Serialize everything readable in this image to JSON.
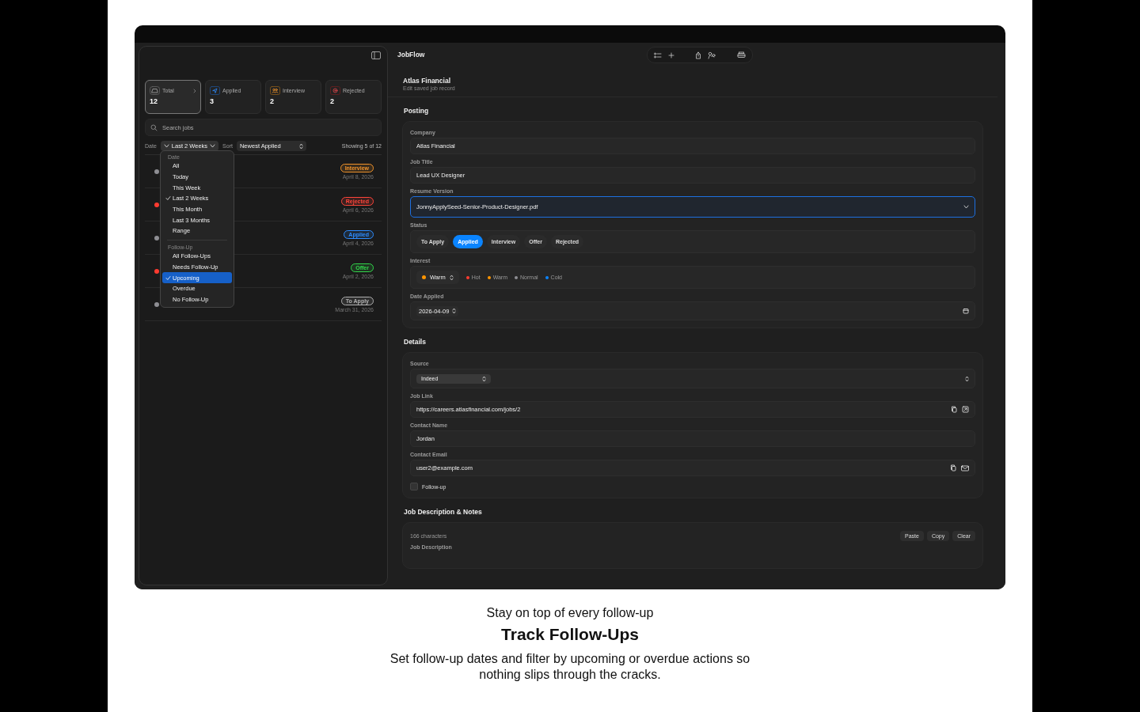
{
  "sidebar": {
    "stats": [
      {
        "kind": "total",
        "label": "Total",
        "value": "12",
        "selected": true
      },
      {
        "kind": "applied",
        "label": "Applied",
        "value": "3",
        "selected": false
      },
      {
        "kind": "interview",
        "label": "Interview",
        "value": "2",
        "selected": false
      },
      {
        "kind": "rejected",
        "label": "Rejected",
        "value": "2",
        "selected": false
      }
    ],
    "search": {
      "placeholder": "Search jobs"
    },
    "filters": {
      "date_label": "Date",
      "date_value": "Last 2 Weeks",
      "sort_label": "Sort",
      "sort_value": "Newest Applied",
      "count": "Showing 5 of 12"
    },
    "jobs": [
      {
        "status": {
          "label": "Interview",
          "color": "#f0932b"
        },
        "date": "April 8, 2026",
        "color": "#8e8e93"
      },
      {
        "status": {
          "label": "Rejected",
          "color": "#ff453a"
        },
        "date": "April 6, 2026",
        "color": "#ff3b30"
      },
      {
        "status": {
          "label": "Applied",
          "color": "#2d8cff"
        },
        "date": "April 4, 2026",
        "color": "#8e8e93"
      },
      {
        "status": {
          "label": "Offer",
          "color": "#32d74b"
        },
        "date": "April 2, 2026",
        "color": "#ff3b30"
      },
      {
        "status": {
          "label": "To Apply",
          "color": "#b0b0b0"
        },
        "date": "March 31, 2026",
        "color": "#8e8e93"
      }
    ],
    "menu": {
      "sections": [
        {
          "title": "Date",
          "items": [
            {
              "label": "All",
              "checked": false,
              "selected": false
            },
            {
              "label": "Today",
              "checked": false,
              "selected": false
            },
            {
              "label": "This Week",
              "checked": false,
              "selected": false
            },
            {
              "label": "Last 2 Weeks",
              "checked": true,
              "selected": false
            },
            {
              "label": "This Month",
              "checked": false,
              "selected": false
            },
            {
              "label": "Last 3 Months",
              "checked": false,
              "selected": false
            },
            {
              "label": "Range",
              "checked": false,
              "selected": false
            }
          ]
        },
        {
          "title": "Follow-Up",
          "items": [
            {
              "label": "All Follow-Ups",
              "checked": false,
              "selected": false
            },
            {
              "label": "Needs Follow-Up",
              "checked": false,
              "selected": false
            },
            {
              "label": "Upcoming",
              "checked": true,
              "selected": true
            },
            {
              "label": "Overdue",
              "checked": false,
              "selected": false
            },
            {
              "label": "No Follow-Up",
              "checked": false,
              "selected": false
            }
          ]
        }
      ]
    }
  },
  "toolbar": {
    "title": "JobFlow"
  },
  "record": {
    "title": "Atlas Financial",
    "subtitle": "Edit saved job record"
  },
  "posting": {
    "heading": "Posting",
    "company": {
      "label": "Company",
      "value": "Atlas Financial"
    },
    "job_title": {
      "label": "Job Title",
      "value": "Lead UX Designer"
    },
    "resume": {
      "label": "Resume Version",
      "value": "JonnyApplySeed-Senior-Product-Designer.pdf"
    },
    "status": {
      "label": "Status",
      "options": [
        {
          "label": "To Apply",
          "selected": false
        },
        {
          "label": "Applied",
          "selected": true
        },
        {
          "label": "Interview",
          "selected": false
        },
        {
          "label": "Offer",
          "selected": false
        },
        {
          "label": "Rejected",
          "selected": false
        }
      ]
    },
    "interest": {
      "label": "Interest",
      "value": "Warm",
      "color": "#ff9500",
      "legend": [
        {
          "label": "Hot",
          "color": "#ff3b30"
        },
        {
          "label": "Warm",
          "color": "#ff9500"
        },
        {
          "label": "Normal",
          "color": "#8e8e93"
        },
        {
          "label": "Cold",
          "color": "#0a84ff"
        }
      ]
    },
    "date_applied": {
      "label": "Date Applied",
      "value": "2026-04-09"
    }
  },
  "details": {
    "heading": "Details",
    "source": {
      "label": "Source",
      "value": "Indeed"
    },
    "job_link": {
      "label": "Job Link",
      "value": "https://careers.atlasfinancial.com/jobs/2"
    },
    "contact_name": {
      "label": "Contact Name",
      "value": "Jordan"
    },
    "contact_email": {
      "label": "Contact Email",
      "value": "user2@example.com"
    },
    "follow_up": {
      "label": "Follow-up",
      "checked": false
    }
  },
  "notes": {
    "heading": "Job Description & Notes",
    "count": "166 characters",
    "buttons": [
      "Paste",
      "Copy",
      "Clear"
    ],
    "label": "Job Description"
  },
  "caption": {
    "kicker": "Stay on top of every follow-up",
    "title": "Track Follow-Ups",
    "body": "Set follow-up dates and filter by upcoming or overdue actions so nothing slips through the cracks."
  }
}
